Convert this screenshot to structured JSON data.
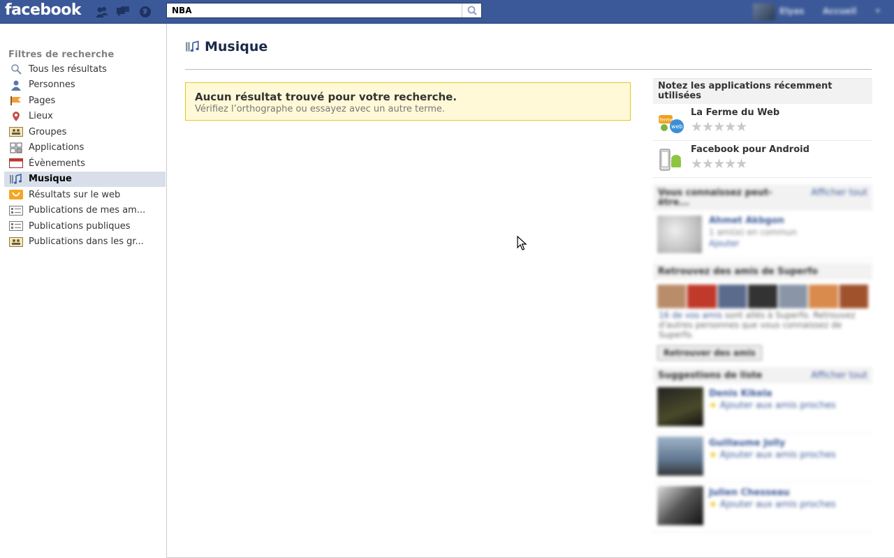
{
  "topbar": {
    "logo": "facebook",
    "search_value": "NBA",
    "user_name": "Elyas",
    "home_label": "Accueil",
    "menu_arrow": "▾"
  },
  "sidebar": {
    "title": "Filtres de recherche",
    "items": [
      {
        "label": "Tous les résultats",
        "icon": "magnifier-icon"
      },
      {
        "label": "Personnes",
        "icon": "person-icon"
      },
      {
        "label": "Pages",
        "icon": "pages-flag-icon"
      },
      {
        "label": "Lieux",
        "icon": "map-pin-icon"
      },
      {
        "label": "Groupes",
        "icon": "group-icon"
      },
      {
        "label": "Applications",
        "icon": "apps-icon"
      },
      {
        "label": "Évènements",
        "icon": "calendar-icon"
      },
      {
        "label": "Musique",
        "icon": "music-icon",
        "active": true
      },
      {
        "label": "Résultats sur le web",
        "icon": "bing-icon"
      },
      {
        "label": "Publications de mes am...",
        "icon": "post-icon"
      },
      {
        "label": "Publications publiques",
        "icon": "post-icon"
      },
      {
        "label": "Publications dans les gr...",
        "icon": "group-icon"
      }
    ]
  },
  "main": {
    "section_title": "Musique",
    "notice_title": "Aucun résultat trouvé pour votre recherche.",
    "notice_text": "Vérifiez l’orthographe ou essayez avec un autre terme."
  },
  "right": {
    "rate_title": "Notez les applications récemment utilisées",
    "apps": [
      {
        "name": "La Ferme du Web",
        "stars": "★★★★★",
        "rating": 0
      },
      {
        "name": "Facebook pour Android",
        "stars": "★★★★★",
        "rating": 0
      }
    ],
    "pymk_title": "Vous connaissez peut-être...",
    "see_all": "Afficher tout",
    "pymk_person": {
      "name": "Ahmet Akbgon",
      "mutual": "1 ami(e) en commun",
      "add": "Ajouter"
    },
    "find_title": "Retrouvez des amis de Superfo",
    "find_text_link": "16 de vos amis",
    "find_text": " sont allés à Superfo. Retrouvez d'autres personnes que vous connaissez de Superfo.",
    "find_button": "Retrouver des amis",
    "sugg_title": "Suggestions de liste",
    "suggestions": [
      {
        "name": "Denis Kikela",
        "action": "Ajouter aux amis proches"
      },
      {
        "name": "Guillaume Jolly",
        "action": "Ajouter aux amis proches"
      },
      {
        "name": "Julien Chesseau",
        "action": "Ajouter aux amis proches"
      }
    ]
  },
  "colors": {
    "brand": "#3b5998",
    "active_filter": "#d8dfea",
    "notice_bg": "#fff9d7",
    "notice_border": "#e2c822"
  }
}
